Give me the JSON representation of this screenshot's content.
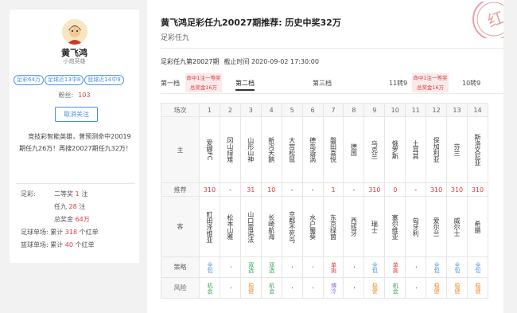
{
  "profile": {
    "name": "黄飞鸿",
    "title": "小炮英雄",
    "tags": [
      "足彩64万",
      "足球近13中8",
      "篮球近14中9"
    ],
    "fans_label": "粉丝:",
    "fans_value": "103",
    "cancel_follow": "取消关注",
    "bio": "竞技彩智能英雄，曾预测命中20019期任九26万！再搜20027期任九32万！",
    "stats": {
      "zucai_label": "足彩:",
      "line1_label": "二等奖",
      "line1_value": "1",
      "line1_unit": "注",
      "line2_label": "任九",
      "line2_value": "28",
      "line2_unit": "注",
      "line3_label": "总奖金",
      "line3_value": "64万",
      "football_label": "足球单场:",
      "football_pre": "累计",
      "football_value": "318",
      "football_unit": "个红单",
      "basketball_label": "篮球单场:",
      "basketball_pre": "累计",
      "basketball_value": "40",
      "basketball_unit": "个红单"
    }
  },
  "header": {
    "title": "黄飞鸿足彩任九20027期推荐: 历史中奖32万",
    "subtitle": "足彩任九",
    "issue": "足彩任九第20027期",
    "deadline": "截止时间 2020-09-02 17:30:00",
    "stamp_text": "红"
  },
  "tabs": {
    "t1": "第一档",
    "t2": "第二档",
    "t3": "第三档",
    "t4": "11转9",
    "t5": "10转9",
    "pill1_a": "命中1注一等奖",
    "pill1_b": "总奖金16万",
    "pill2_a": "命中1注一等奖",
    "pill2_b": "总奖金16万"
  },
  "table": {
    "row_labels": {
      "match": "场次",
      "home": "主",
      "rec": "推荐",
      "away": "客",
      "strategy": "策略",
      "risk": "风险"
    },
    "matches": [
      "1",
      "2",
      "3",
      "4",
      "5",
      "6",
      "7",
      "8",
      "9",
      "10",
      "11",
      "12",
      "13",
      "14"
    ],
    "home": [
      "爱娜FC",
      "冈山绿雉",
      "山形山神",
      "新泻天鹅",
      "大宫松鼠",
      "德岛漩涡",
      "磐田喜悦",
      "德国",
      "乌克兰",
      "俄罗斯",
      "土耳其",
      "保加利亚",
      "芬兰",
      "斯洛文尼亚"
    ],
    "rec": [
      "310",
      "-",
      "31",
      "10",
      "-",
      "-",
      "1",
      "-",
      "310",
      "0",
      "-",
      "310",
      "310",
      "310"
    ],
    "away": [
      "町田泽维亚",
      "松本山雅",
      "山口雷诺法",
      "长崎航海",
      "京都不死鸟",
      "水户蜀葵",
      "东京绿茵",
      "西班牙",
      "瑞士",
      "塞尔维亚",
      "匈牙利",
      "爱尔兰",
      "威尔士",
      "希腊"
    ],
    "strategy": [
      "全包",
      "-",
      "双选",
      "双选",
      "-",
      "-",
      "单挑",
      "-",
      "全包",
      "单挑",
      "-",
      "全包",
      "全包",
      "全包"
    ],
    "risk": [
      "机会",
      "-",
      "稳健",
      "机会",
      "-",
      "-",
      "博冷",
      "-",
      "稳健",
      "机会",
      "-",
      "稳健",
      "稳健",
      "稳健"
    ],
    "colors": {
      "blue": "#4a90e2",
      "red": "#e03c3c",
      "green": "#2ea44f",
      "orange": "#f08c2e",
      "purple": "#8e6dd8"
    }
  }
}
